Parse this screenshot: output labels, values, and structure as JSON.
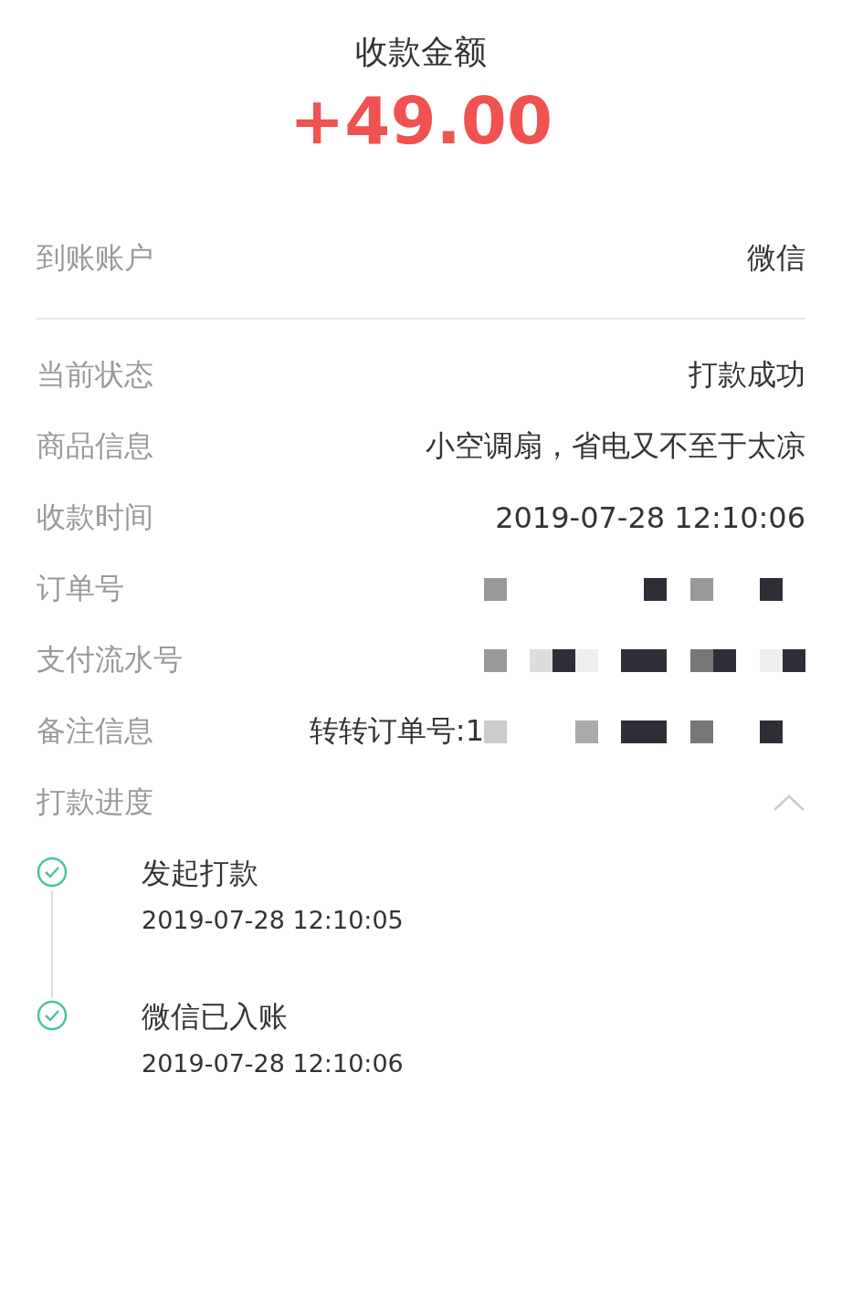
{
  "header": {
    "title": "收款金额",
    "amount": "+49.00"
  },
  "account": {
    "label": "到账账户",
    "value": "微信"
  },
  "details": [
    {
      "kind": "text",
      "label": "当前状态",
      "value": "打款成功"
    },
    {
      "kind": "text",
      "label": "商品信息",
      "value": "小空调扇，省电又不至于太凉"
    },
    {
      "kind": "text",
      "label": "收款时间",
      "value": "2019-07-28 12:10:06"
    },
    {
      "kind": "masked",
      "label": "订单号"
    },
    {
      "kind": "masked",
      "label": "支付流水号"
    },
    {
      "kind": "partial",
      "label": "备注信息",
      "value": "转转订单号:1"
    }
  ],
  "progress": {
    "label": "打款进度",
    "expanded": true,
    "steps": [
      {
        "title": "发起打款",
        "time": "2019-07-28 12:10:05",
        "done": true
      },
      {
        "title": "微信已入账",
        "time": "2019-07-28 12:10:06",
        "done": true
      }
    ]
  }
}
